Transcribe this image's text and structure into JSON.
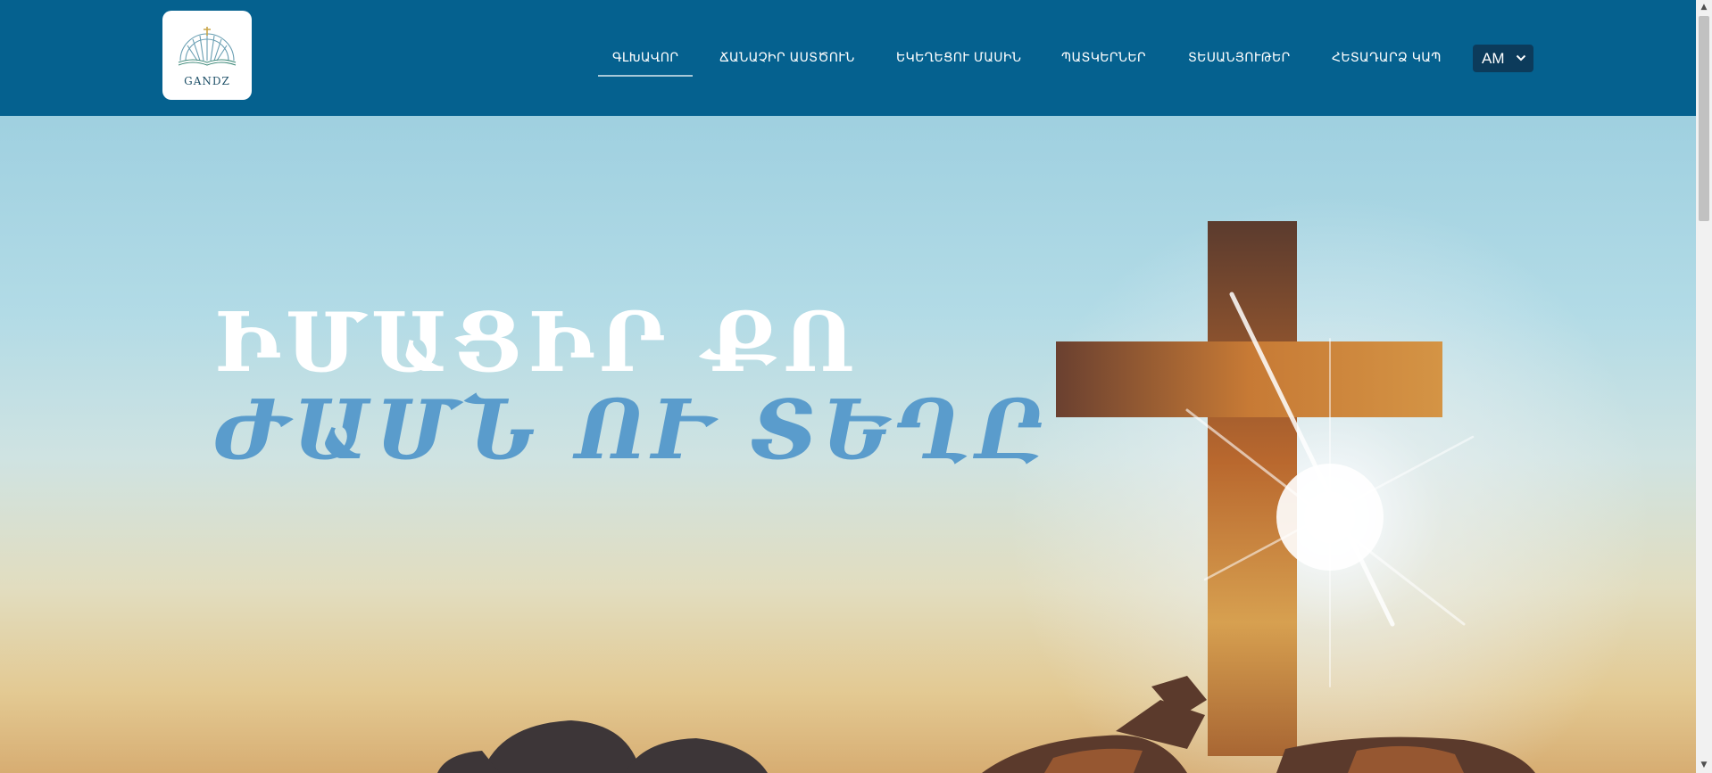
{
  "logo": {
    "text": "GANDZ",
    "icon": "gandz-logo-icon"
  },
  "nav": {
    "items": [
      {
        "label": "ԳԼԽԱՎՈՐ",
        "active": true
      },
      {
        "label": "ՃԱՆԱՉԻՐ ԱՍՏԾՈՒՆ",
        "active": false
      },
      {
        "label": "ԵԿԵՂԵՑՈՒ ՄԱՍԻՆ",
        "active": false
      },
      {
        "label": "ՊԱՏԿԵՐՆԵՐ",
        "active": false
      },
      {
        "label": "ՏԵՍԱՆՅՈՒԹԵՐ",
        "active": false
      },
      {
        "label": "ՀԵՏԱԴԱՐՁ ԿԱՊ",
        "active": false
      }
    ]
  },
  "language": {
    "selected": "AM",
    "icon": "chevron-down-icon"
  },
  "hero": {
    "headline_line1": "ԻՄԱՑԻՐ ՔՈ",
    "headline_line2": "ԺԱՄՆ ՈՒ ՏԵՂԸ",
    "image": "cross-at-sunrise"
  },
  "colors": {
    "header_bg": "#05618f",
    "headline_primary": "#ffffff",
    "headline_accent": "#5a9ccc",
    "lang_bg": "#0c3b5b"
  }
}
